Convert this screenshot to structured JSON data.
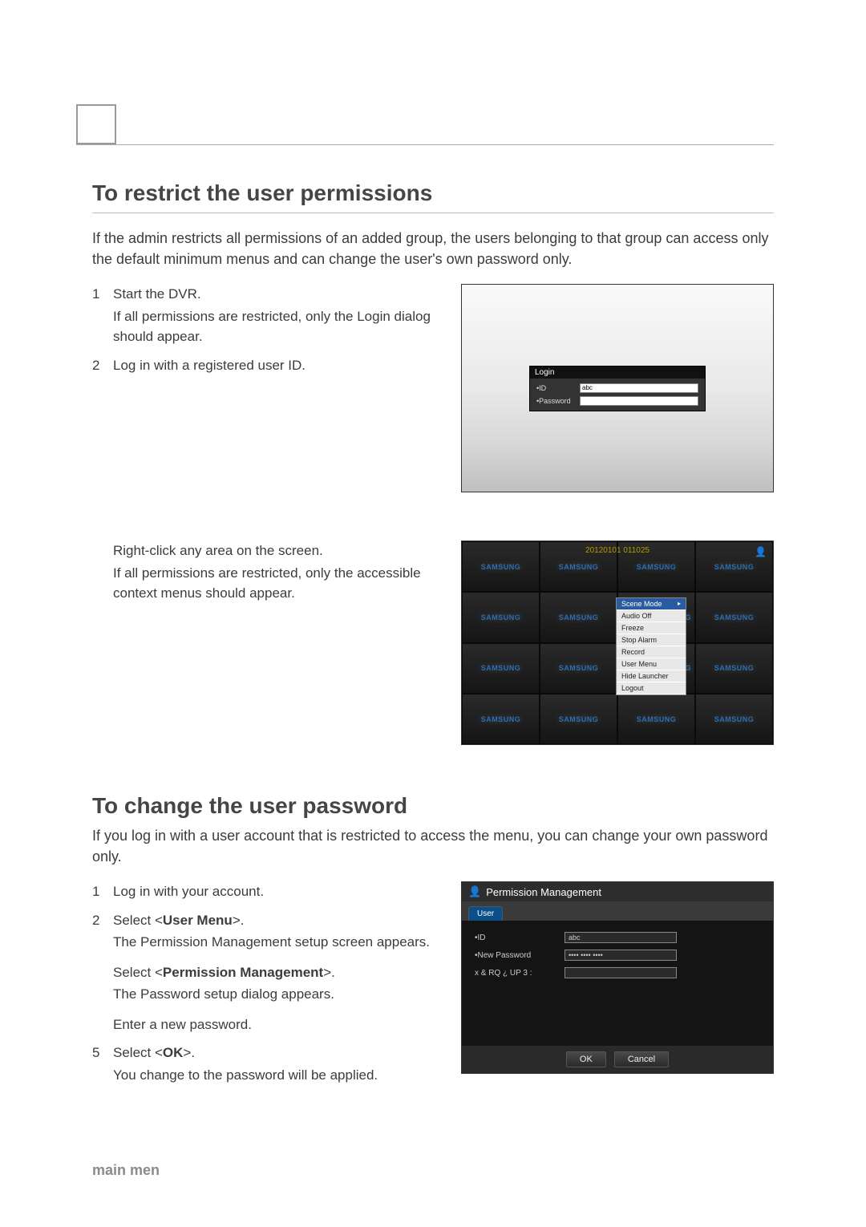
{
  "footer": "main men",
  "section1": {
    "title": "To restrict the user permissions",
    "intro": "If the admin restricts all permissions of an added group, the users belonging to that group can access only the default minimum menus and can change the user's own password only.",
    "steps": [
      {
        "num": "1",
        "text": "Start the DVR.",
        "sub1": "If all permissions are restricted, only the Login dialog should appear."
      },
      {
        "num": "2",
        "text": "Log in with a registered user ID."
      }
    ],
    "midstep": {
      "text": "Right-click any area on the screen.",
      "sub": "If all permissions are restricted, only the accessible context menus should appear."
    }
  },
  "login_fig": {
    "title": "Login",
    "id_label": "ID",
    "id_bullet": "•",
    "id_value": "abc",
    "pw_label": "Password",
    "pw_bullet": "•"
  },
  "grid_fig": {
    "logo": "SAMSUNG",
    "timestamp": "20120101 011025",
    "user_glyph": "👤",
    "menu": [
      "Scene Mode",
      "Audio Off",
      "Freeze",
      "Stop Alarm",
      "Record",
      "User Menu",
      "Hide Launcher",
      "Logout"
    ]
  },
  "section2": {
    "title": "To change the user password",
    "intro": "If you log in with a user account that is restricted to access the menu, you can change your own password only.",
    "steps": [
      {
        "num": "1",
        "text1": "Log in with your account."
      },
      {
        "num": "2",
        "pre": "Select <",
        "bold": "User Menu",
        "post": ">.",
        "sub": "The Permission Management setup screen appears."
      },
      {
        "num": "",
        "pre": "Select <",
        "bold": "Permission Management",
        "post": ">.",
        "sub": "The Password setup dialog appears."
      },
      {
        "num": "",
        "text1": "Enter a new password."
      },
      {
        "num": "5",
        "pre": "Select <",
        "bold": "OK",
        "post": ">.",
        "sub": "You change to the password will be applied."
      }
    ]
  },
  "perm_fig": {
    "icon": "👤",
    "title": "Permission Management",
    "tab": "User",
    "rows": [
      {
        "label": "ID",
        "bullet": "•",
        "value": "abc"
      },
      {
        "label": "New Password",
        "bullet": "•",
        "value": "•••• •••• ••••"
      },
      {
        "label": "x & RQ ¿ UP 3 :",
        "bullet": "",
        "value": ""
      }
    ],
    "ok": "OK",
    "cancel": "Cancel"
  }
}
